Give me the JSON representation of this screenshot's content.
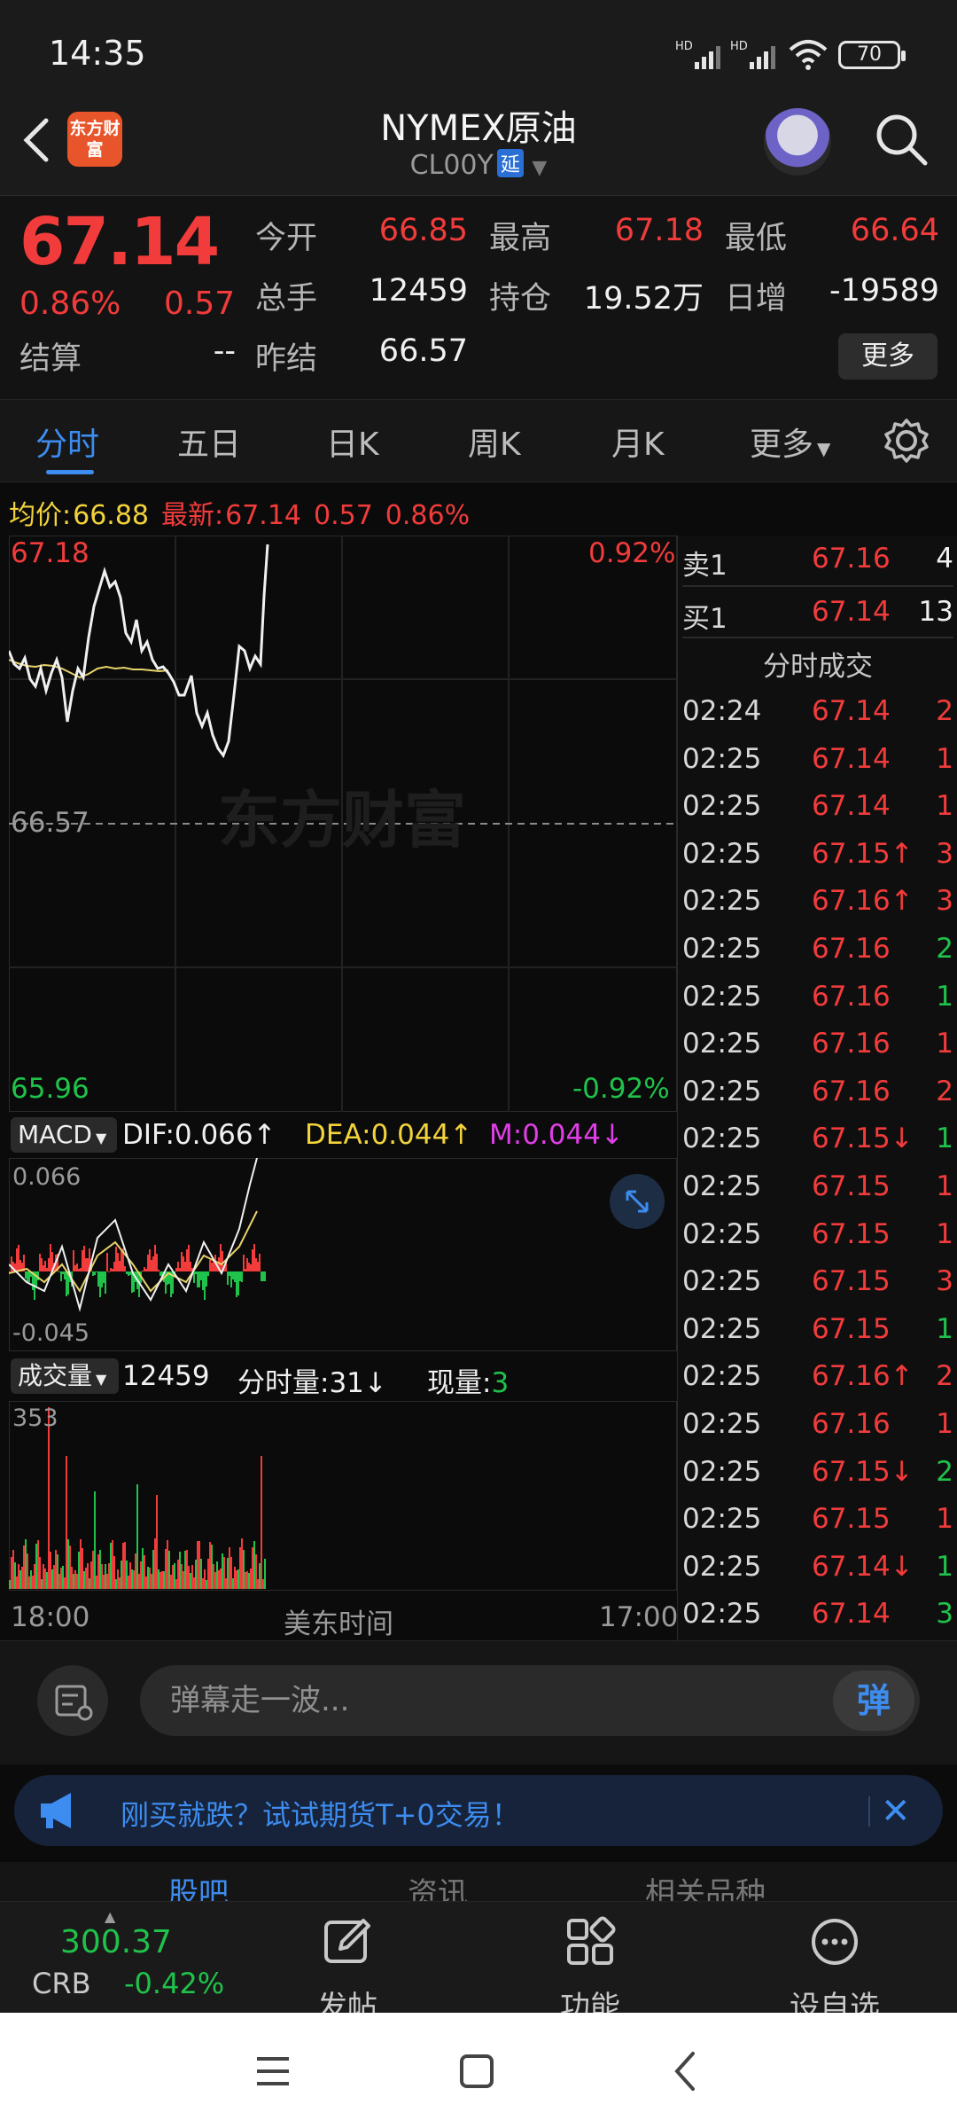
{
  "status_bar": {
    "time": "14:35",
    "battery": "70",
    "net1": "HD",
    "net2": "HD"
  },
  "header": {
    "logo_text": "东方财富",
    "title": "NYMEX原油",
    "code": "CL00Y",
    "delay_badge": "延"
  },
  "quote": {
    "last_price": "67.14",
    "change_pct": "0.86%",
    "change_amt": "0.57",
    "rows": [
      [
        {
          "label": "今开",
          "value": "66.85",
          "color": "red"
        },
        {
          "label": "最高",
          "value": "67.18",
          "color": "red"
        },
        {
          "label": "最低",
          "value": "66.64",
          "color": "red"
        }
      ],
      [
        {
          "label": "总手",
          "value": "12459",
          "color": "white"
        },
        {
          "label": "持仓",
          "value": "19.52万",
          "color": "white"
        },
        {
          "label": "日增",
          "value": "-19589",
          "color": "white"
        }
      ],
      [
        {
          "label": "结算",
          "value": "--",
          "color": "white"
        },
        {
          "label": "昨结",
          "value": "66.57",
          "color": "white"
        }
      ]
    ],
    "more_label": "更多"
  },
  "tabs": [
    "分时",
    "五日",
    "日K",
    "周K",
    "月K",
    "更多"
  ],
  "info_line": {
    "avg_label": "均价:",
    "avg_value": "66.88",
    "latest_label": "最新:",
    "latest_value": "67.14",
    "chg": "0.57",
    "pct": "0.86%"
  },
  "price_chart": {
    "top_price": "67.18",
    "top_pct": "0.92%",
    "mid_price": "66.57",
    "bottom_price": "65.96",
    "bottom_pct": "-0.92%",
    "watermark": "东方财富"
  },
  "macd": {
    "label": "MACD",
    "dif": "DIF:0.066",
    "dea": "DEA:0.044",
    "m": "M:0.044",
    "top": "0.066",
    "bottom": "-0.045"
  },
  "volume": {
    "label": "成交量",
    "total": "12459",
    "minute_vol": "分时量:31",
    "now_label": "现量:",
    "now_value": "3",
    "max": "353"
  },
  "time_axis": {
    "start": "18:00",
    "center": "美东时间",
    "end": "17:00"
  },
  "order_book": {
    "ask": {
      "label": "卖1",
      "price": "67.16",
      "vol": "4"
    },
    "bid": {
      "label": "买1",
      "price": "67.14",
      "vol": "13"
    },
    "ticks_title": "分时成交",
    "ticks": [
      {
        "t": "02:24",
        "p": "67.14",
        "v": "2",
        "c": "red"
      },
      {
        "t": "02:25",
        "p": "67.14",
        "v": "1",
        "c": "red"
      },
      {
        "t": "02:25",
        "p": "67.14",
        "v": "1",
        "c": "red"
      },
      {
        "t": "02:25",
        "p": "67.15↑",
        "v": "3",
        "c": "red"
      },
      {
        "t": "02:25",
        "p": "67.16↑",
        "v": "3",
        "c": "red"
      },
      {
        "t": "02:25",
        "p": "67.16",
        "v": "2",
        "c": "green"
      },
      {
        "t": "02:25",
        "p": "67.16",
        "v": "1",
        "c": "green"
      },
      {
        "t": "02:25",
        "p": "67.16",
        "v": "1",
        "c": "red"
      },
      {
        "t": "02:25",
        "p": "67.16",
        "v": "2",
        "c": "red"
      },
      {
        "t": "02:25",
        "p": "67.15↓",
        "v": "1",
        "c": "green"
      },
      {
        "t": "02:25",
        "p": "67.15",
        "v": "1",
        "c": "red"
      },
      {
        "t": "02:25",
        "p": "67.15",
        "v": "1",
        "c": "red"
      },
      {
        "t": "02:25",
        "p": "67.15",
        "v": "3",
        "c": "red"
      },
      {
        "t": "02:25",
        "p": "67.15",
        "v": "1",
        "c": "green"
      },
      {
        "t": "02:25",
        "p": "67.16↑",
        "v": "2",
        "c": "red"
      },
      {
        "t": "02:25",
        "p": "67.16",
        "v": "1",
        "c": "red"
      },
      {
        "t": "02:25",
        "p": "67.15↓",
        "v": "2",
        "c": "green"
      },
      {
        "t": "02:25",
        "p": "67.15",
        "v": "1",
        "c": "red"
      },
      {
        "t": "02:25",
        "p": "67.14↓",
        "v": "1",
        "c": "green"
      },
      {
        "t": "02:25",
        "p": "67.14",
        "v": "3",
        "c": "green"
      }
    ]
  },
  "bullet": {
    "placeholder": "弹幕走一波...",
    "send_label": "弹"
  },
  "promo": {
    "text": "刚买就跌？试试期货T+0交易！"
  },
  "sub_tabs": [
    "股吧",
    "资讯",
    "相关品种"
  ],
  "bottom_nav": {
    "crb_value": "300.37",
    "crb_name": "CRB",
    "crb_change": "-0.42%",
    "items": [
      "发帖",
      "功能",
      "设自选"
    ]
  },
  "colors": {
    "up": "#f23b3b",
    "down": "#1fc24a",
    "accent": "#3d8cf0",
    "avg_line": "#e8d36a"
  }
}
